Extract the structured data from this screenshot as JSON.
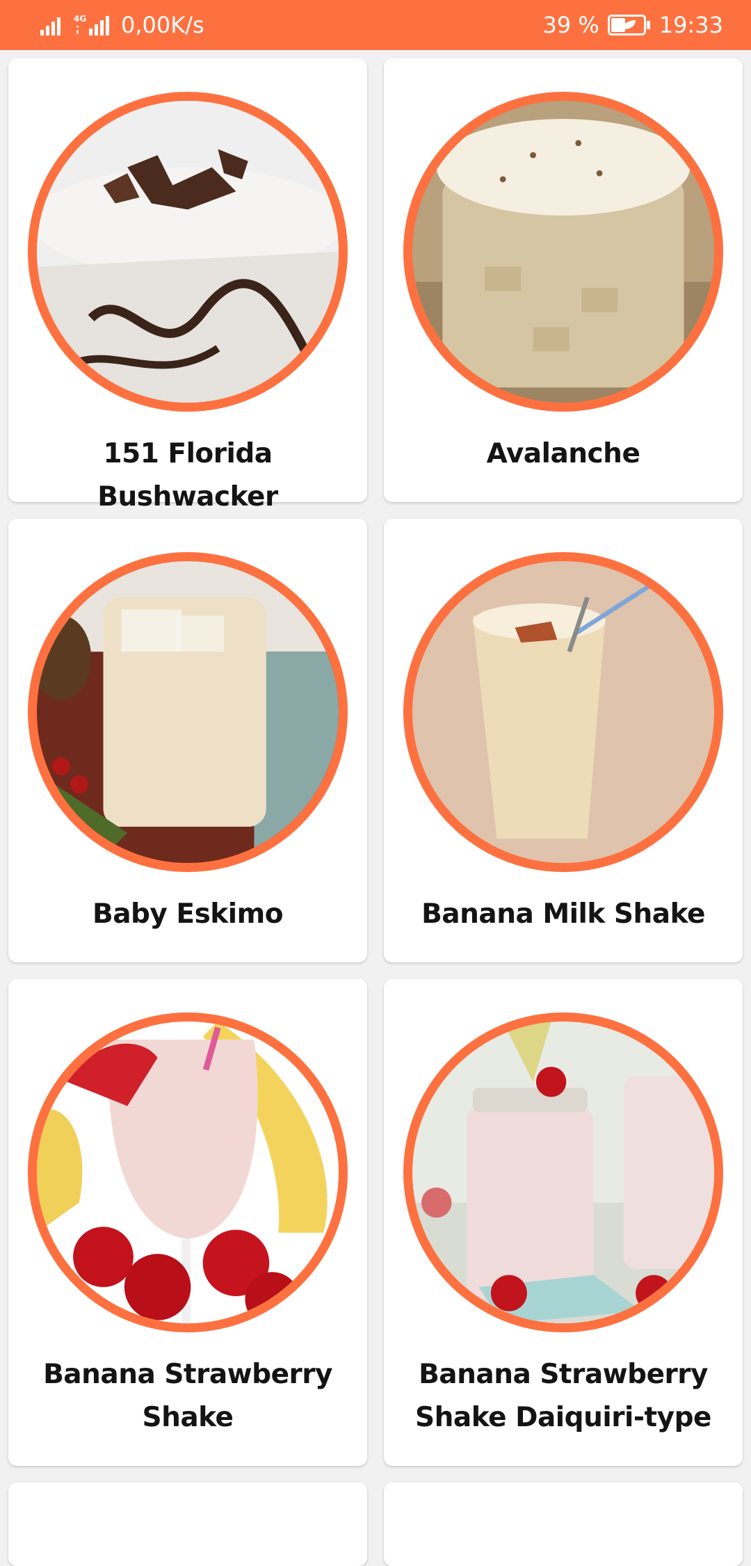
{
  "status_bar": {
    "network_label": "4G",
    "speed": "0,00K/s",
    "battery_percent": "39 %",
    "time": "19:33",
    "background_color": "#fd7140"
  },
  "accent_color": "#fd7140",
  "drinks": [
    {
      "name": "151 Florida Bushwacker",
      "image": "chocolate-shake-image"
    },
    {
      "name": "Avalanche",
      "image": "iced-cream-drink-image"
    },
    {
      "name": "Baby Eskimo",
      "image": "creamy-cocktail-image"
    },
    {
      "name": "Banana Milk Shake",
      "image": "banana-shake-image"
    },
    {
      "name": "Banana Strawberry Shake",
      "image": "strawberry-shake-glass-image"
    },
    {
      "name": "Banana Strawberry Shake Daiquiri-type",
      "image": "strawberry-shake-jar-image"
    }
  ]
}
